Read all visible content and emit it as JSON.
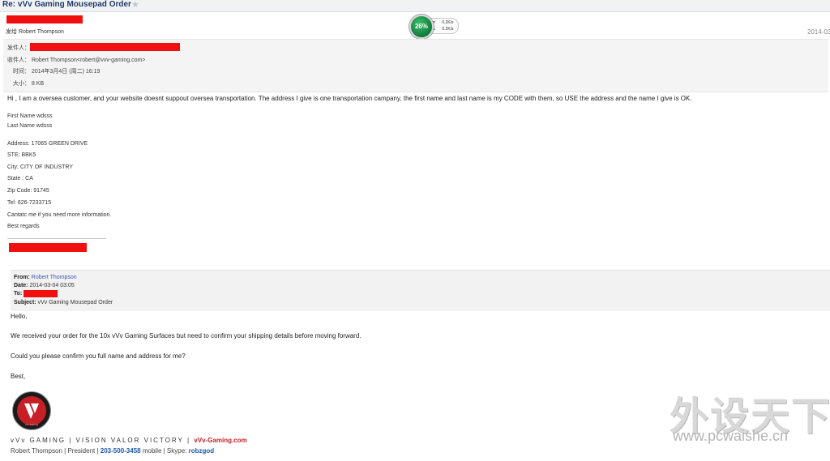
{
  "window": {
    "title": "Re: vVv Gaming Mousepad Order",
    "star_icon": "star-icon"
  },
  "header": {
    "sender_label": "发给",
    "sender_name": "Robert Thompson",
    "date_right": "2014-03"
  },
  "meta": {
    "from_label": "发件人：",
    "to_label": "收件人：",
    "to_value": "Robert Thompson<robert@vvv-gaming.com>",
    "time_label": "时间：",
    "time_value": "2014年3月4日 (周二) 16:19",
    "size_label": "大小：",
    "size_value": "8 KB"
  },
  "speed_widget": {
    "percent": "26%",
    "upload": "0.2K/s",
    "download": "0.2K/s",
    "up_icon": "arrow-up-icon",
    "down_icon": "arrow-down-icon"
  },
  "reply": {
    "intro": "Hi , I am  a oversea customer,  and  your website doesnt suppout oversea transportation. The address I give is one transportation campany, the first name and last name is my CODE with them, so USE the address and the  name I give is OK.",
    "first_name": "First Name   wdsss",
    "last_name": "Last Name   wdsss",
    "address": "Address: 17065 GREEN DRIVE",
    "ste": "STE: BBK5",
    "city": "City: CITY OF INDUSTRY",
    "state": "State : CA",
    "zip": "Zip Code:  91745",
    "tel": "Tel: 626-7233715",
    "contact": "Cantatc me if you need more information.",
    "regards": "Best regards"
  },
  "quoted": {
    "from_label": "From:",
    "from_value": "Robert Thompson",
    "date_label": "Date:",
    "date_value": "2014-03-04 03:05",
    "to_label": "To:",
    "subject_label": "Subject:",
    "subject_value": "vVv Gaming Mousepad Order",
    "hello": "Hello,",
    "line1": "We received your order for the 10x vVv Gaming Surfaces but need to confirm your shipping details before moving forward.",
    "line2": "Could you please confirm you full name and address for me?",
    "best": "Best,"
  },
  "signature": {
    "logo_icon": "vvv-logo-icon",
    "logo_caption": "vVv Gaming",
    "tagline": "vVv GAMING  |  VISION VALOR VICTORY  |",
    "site": "vVv-Gaming.com",
    "name": "Robert Thompson",
    "sep1": "|",
    "role": "President",
    "sep2": "|",
    "phone": "203-500-3458",
    "phone_suffix": "mobile | Skype:",
    "skype": "robzgod"
  },
  "watermark": {
    "text": "外设天下",
    "url": "www.pcwaishe.cn"
  },
  "colors": {
    "redaction": "#f01010",
    "brand_red": "#c62026",
    "link_blue": "#3a56b0",
    "gauge_green": "#0f7a3a"
  }
}
